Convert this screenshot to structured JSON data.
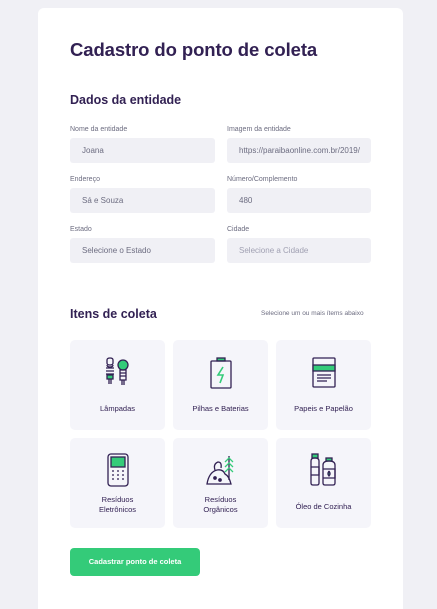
{
  "form": {
    "title": "Cadastro do ponto de coleta",
    "entity_section": "Dados da entidade",
    "fields": {
      "nome": {
        "label": "Nome da entidade",
        "value": "Joana"
      },
      "imagem": {
        "label": "Imagem da entidade",
        "value": "https://paraibaonline.com.br/2019/"
      },
      "endereco": {
        "label": "Endereço",
        "value": "Sá e Souza"
      },
      "numero": {
        "label": "Número/Complemento",
        "value": "480"
      },
      "estado": {
        "label": "Estado",
        "value": "Selecione o Estado"
      },
      "cidade": {
        "label": "Cidade",
        "placeholder": "Selecione a Cidade"
      }
    },
    "items_section": "Itens de coleta",
    "items_hint": "Selecione um ou mais ítems abaixo",
    "items": [
      {
        "label": "Lâmpadas",
        "icon": "lamp-icon"
      },
      {
        "label": "Pilhas e Baterias",
        "icon": "battery-icon"
      },
      {
        "label": "Papeis e Papelão",
        "icon": "paper-icon"
      },
      {
        "label": "Resíduos\nEletrônicos",
        "icon": "electronics-icon"
      },
      {
        "label": "Resíduos\nOrgânicos",
        "icon": "organic-icon"
      },
      {
        "label": "Óleo de Cozinha",
        "icon": "oil-icon"
      }
    ],
    "submit_label": "Cadastrar ponto de coleta"
  },
  "colors": {
    "primary": "#34cb79",
    "title": "#322153",
    "input_bg": "#f0f0f5"
  }
}
